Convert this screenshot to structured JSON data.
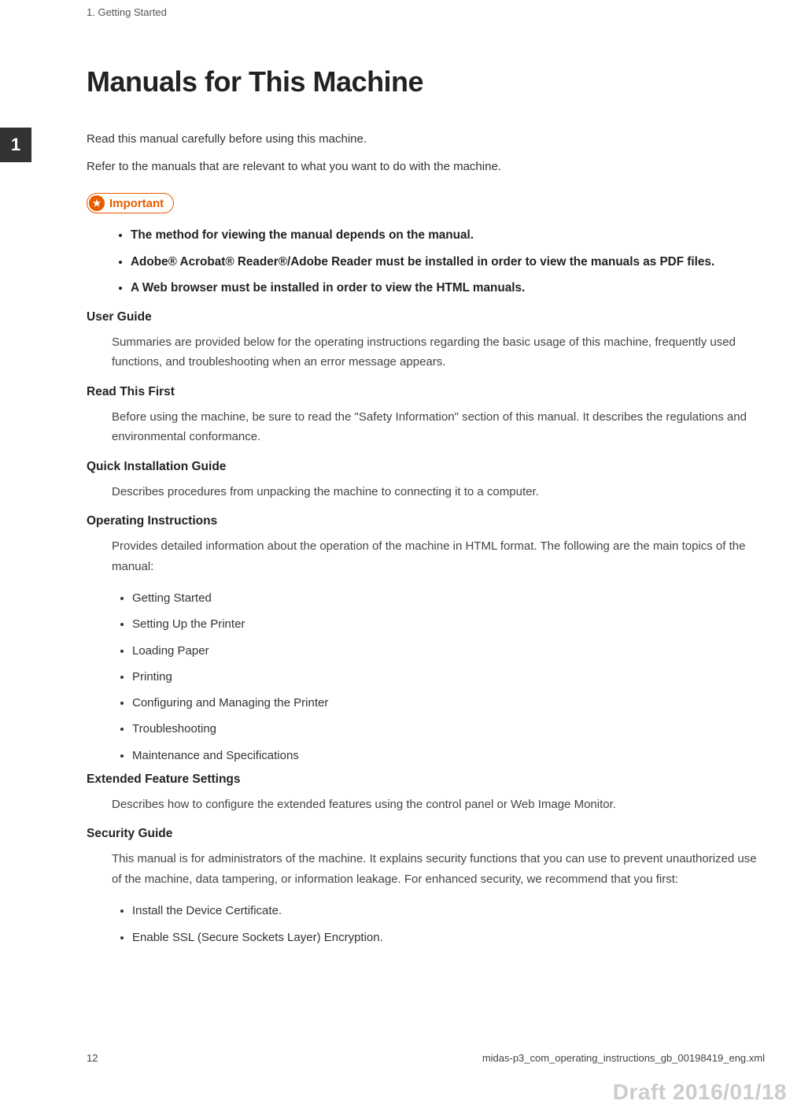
{
  "header": {
    "section": "1. Getting Started",
    "chapterTab": "1"
  },
  "title": "Manuals for This Machine",
  "intro1": "Read this manual carefully before using this machine.",
  "intro2": "Refer to the manuals that are relevant to what you want to do with the machine.",
  "importantLabel": "Important",
  "importantItems": [
    "The method for viewing the manual depends on the manual.",
    "Adobe® Acrobat® Reader®/Adobe Reader must be installed in order to view the manuals as PDF files.",
    "A Web browser must be installed in order to view the HTML manuals."
  ],
  "sections": [
    {
      "title": "User Guide",
      "body": "Summaries are provided below for the operating instructions regarding the basic usage of this machine, frequently used functions, and troubleshooting when an error message appears."
    },
    {
      "title": "Read This First",
      "body": "Before using the machine, be sure to read the \"Safety Information\" section of this manual. It describes the regulations and environmental conformance."
    },
    {
      "title": "Quick Installation Guide",
      "body": "Describes procedures from unpacking the machine to connecting it to a computer."
    },
    {
      "title": "Operating Instructions",
      "body": "Provides detailed information about the operation of the machine in HTML format. The following are the main topics of the manual:",
      "list": [
        "Getting Started",
        "Setting Up the Printer",
        "Loading Paper",
        "Printing",
        "Configuring and Managing the Printer",
        "Troubleshooting",
        "Maintenance and Specifications"
      ]
    },
    {
      "title": "Extended Feature Settings",
      "body": "Describes how to configure the extended features using the control panel or Web Image Monitor."
    },
    {
      "title": "Security Guide",
      "body": "This manual is for administrators of the machine. It explains security functions that you can use to prevent unauthorized use of the machine, data tampering, or information leakage. For enhanced security, we recommend that you first:",
      "list": [
        "Install the Device Certificate.",
        "Enable SSL (Secure Sockets Layer) Encryption."
      ]
    }
  ],
  "footer": {
    "pageNumber": "12",
    "filename": "midas-p3_com_operating_instructions_gb_00198419_eng.xml"
  },
  "draftStamp": "Draft 2016/01/18"
}
